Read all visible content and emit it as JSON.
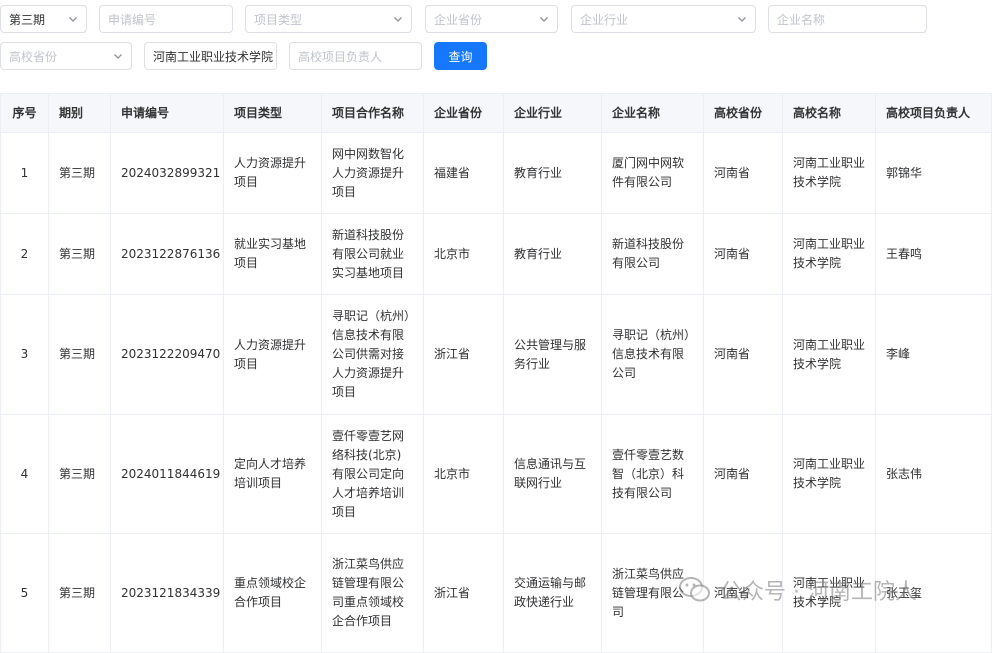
{
  "filters": {
    "period": {
      "value": "第三期"
    },
    "application_no": {
      "placeholder": "申请编号"
    },
    "project_type": {
      "placeholder": "项目类型"
    },
    "company_province": {
      "placeholder": "企业省份"
    },
    "company_industry": {
      "placeholder": "企业行业"
    },
    "company_name": {
      "placeholder": "企业名称"
    },
    "school_province": {
      "placeholder": "高校省份"
    },
    "school_name": {
      "value": "河南工业职业技术学院"
    },
    "school_leader": {
      "placeholder": "高校项目负责人"
    },
    "query_label": "查询"
  },
  "table": {
    "headers": [
      "序号",
      "期别",
      "申请编号",
      "项目类型",
      "项目合作名称",
      "企业省份",
      "企业行业",
      "企业名称",
      "高校省份",
      "高校名称",
      "高校项目负责人"
    ],
    "rows": [
      [
        "1",
        "第三期",
        "2024032899321",
        "人力资源提升项目",
        "网中网数智化人力资源提升项目",
        "福建省",
        "教育行业",
        "厦门网中网软件有限公司",
        "河南省",
        "河南工业职业技术学院",
        "郭锦华"
      ],
      [
        "2",
        "第三期",
        "2023122876136",
        "就业实习基地项目",
        "新道科技股份有限公司就业实习基地项目",
        "北京市",
        "教育行业",
        "新道科技股份有限公司",
        "河南省",
        "河南工业职业技术学院",
        "王春鸣"
      ],
      [
        "3",
        "第三期",
        "2023122209470",
        "人力资源提升项目",
        "寻职记（杭州）信息技术有限公司供需对接人力资源提升项目",
        "浙江省",
        "公共管理与服务行业",
        "寻职记（杭州）信息技术有限公司",
        "河南省",
        "河南工业职业技术学院",
        "李峰"
      ],
      [
        "4",
        "第三期",
        "2024011844619",
        "定向人才培养培训项目",
        "壹仟零壹艺网络科技(北京)有限公司定向人才培养培训项目",
        "北京市",
        "信息通讯与互联网行业",
        "壹仟零壹艺数智（北京）科技有限公司",
        "河南省",
        "河南工业职业技术学院",
        "张志伟"
      ],
      [
        "5",
        "第三期",
        "2023121834339",
        "重点领域校企合作项目",
        "浙江菜鸟供应链管理有限公司重点领域校企合作项目",
        "浙江省",
        "交通运输与邮政快递行业",
        "浙江菜鸟供应链管理有限公司",
        "河南省",
        "河南工业职业技术学院",
        "张玉玺"
      ]
    ]
  },
  "watermark": {
    "text": "公众号 · 河南工院人"
  }
}
